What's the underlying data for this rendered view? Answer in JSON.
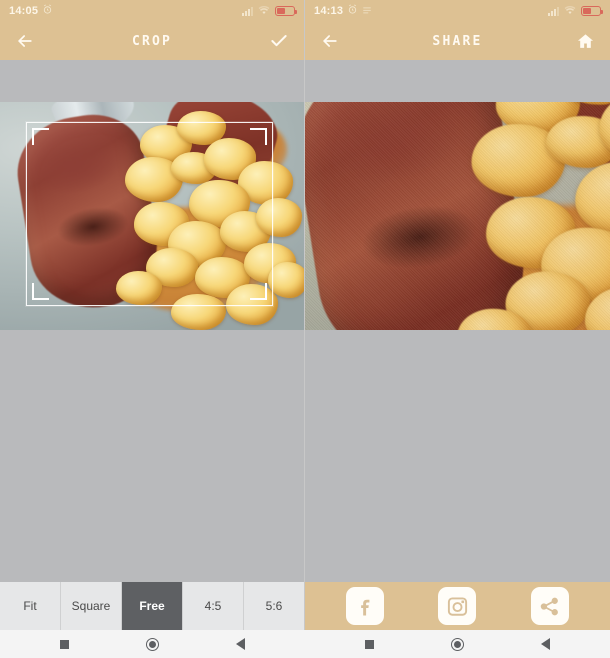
{
  "left_panel": {
    "status_bar": {
      "time": "14:05",
      "alarm_icon": "alarm-clock-icon",
      "signal_icon": "cellular-signal-icon",
      "wifi_icon": "wifi-icon",
      "battery_icon": "battery-icon"
    },
    "app_bar": {
      "back_icon": "back-arrow-icon",
      "title": "CROP",
      "confirm_icon": "checkmark-icon"
    },
    "crop_overlay": {
      "handle_icon": "crop-corner-handle-icon"
    },
    "toolbar": {
      "options": [
        {
          "label": "Fit",
          "active": false
        },
        {
          "label": "Square",
          "active": false
        },
        {
          "label": "Free",
          "active": true
        },
        {
          "label": "4:5",
          "active": false
        },
        {
          "label": "5:6",
          "active": false
        }
      ]
    }
  },
  "right_panel": {
    "status_bar": {
      "time": "14:13",
      "alarm_icon": "alarm-clock-icon",
      "note_icon": "notification-icon",
      "signal_icon": "cellular-signal-icon",
      "wifi_icon": "wifi-icon",
      "battery_icon": "battery-icon"
    },
    "app_bar": {
      "back_icon": "back-arrow-icon",
      "title": "SHARE",
      "home_icon": "home-icon"
    },
    "toolbar": {
      "buttons": [
        {
          "icon": "facebook-icon",
          "label": "f"
        },
        {
          "icon": "instagram-icon",
          "label": ""
        },
        {
          "icon": "share-icon",
          "label": ""
        }
      ]
    }
  },
  "nav_bar": {
    "recents_icon": "recents-square-icon",
    "home_icon": "home-circle-icon",
    "back_icon": "back-triangle-icon"
  },
  "colors": {
    "accent": "#ddc193",
    "backdrop": "#b9babc",
    "toolbar_idle": "#e6e7e8",
    "toolbar_active": "#5e6063",
    "nav_bg": "#f4f4f4",
    "battery_red": "#d9695b"
  }
}
